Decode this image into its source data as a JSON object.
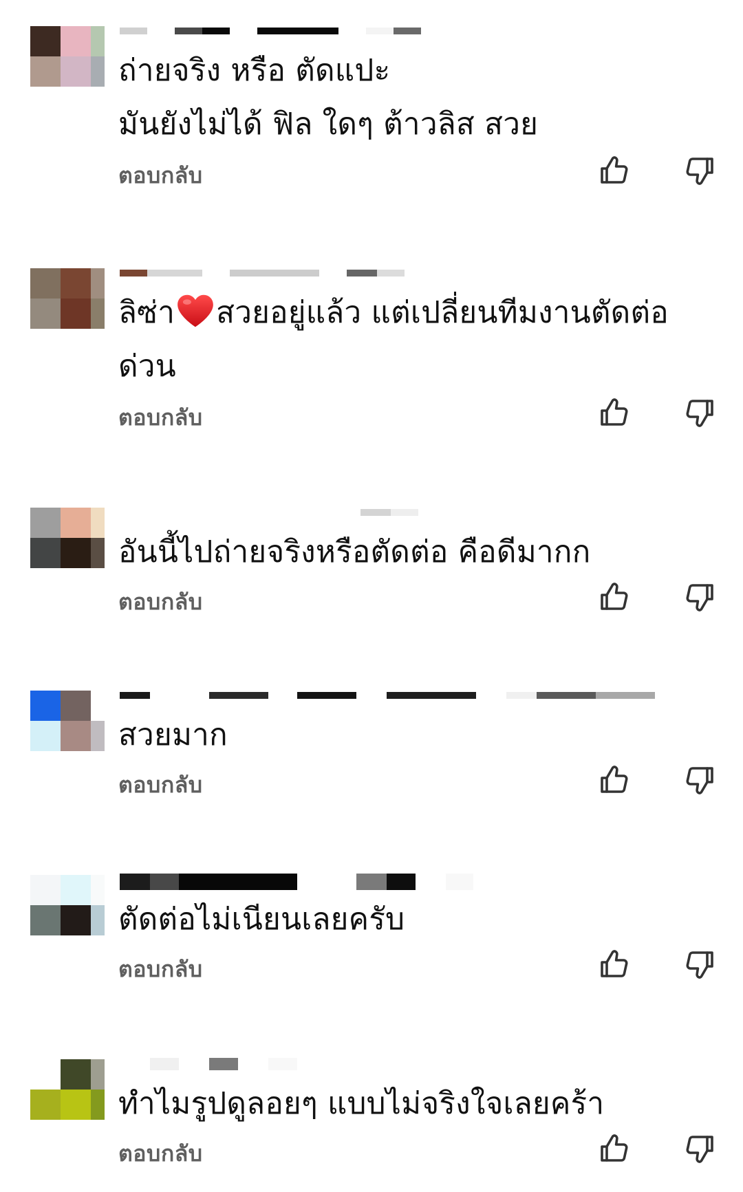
{
  "comments": [
    {
      "text": "ถ่ายจริง หรือ ตัดแปะ\nมันยังไม่ได้ ฟิล ใดๆ ต้าวลิส สวย",
      "reply_label": "ตอบกลับ",
      "like_icon": "thumbs-up-icon",
      "dislike_icon": "thumbs-down-icon",
      "avatar_colors": [
        "#3d2a22",
        "#e8b5c0",
        "#b5c8b0",
        "#b09a8e",
        "#d2b6c5",
        "#a8adb2"
      ]
    },
    {
      "text_before_heart": "ลิซ่า",
      "text_after_heart": "สวยอยู่แล้ว แต่เปลี่ยนทีมงานตัดต่อด่วน",
      "reply_label": "ตอบกลับ",
      "like_icon": "thumbs-up-icon",
      "dislike_icon": "thumbs-down-icon",
      "heart_icon": "red-heart-icon",
      "avatar_colors": [
        "#80705f",
        "#7a4632",
        "#a08e80",
        "#948a7e",
        "#6e3626",
        "#8a7e6a"
      ]
    },
    {
      "text": "อันนี้ไปถ่ายจริงหรือตัดต่อ คือดีมากก",
      "reply_label": "ตอบกลับ",
      "like_icon": "thumbs-up-icon",
      "dislike_icon": "thumbs-down-icon",
      "avatar_colors": [
        "#9e9e9e",
        "#e6ae96",
        "#f0dcc0",
        "#434545",
        "#2a1d14",
        "#5a4e44"
      ]
    },
    {
      "text": "สวยมาก",
      "reply_label": "ตอบกลับ",
      "like_icon": "thumbs-up-icon",
      "dislike_icon": "thumbs-down-icon",
      "avatar_colors": [
        "#1a64e6",
        "#736360",
        "#ffffff",
        "#d4f0f8",
        "#a88a84",
        "#c0bcc0"
      ]
    },
    {
      "text": "ตัดต่อไม่เนียนเลยครับ",
      "reply_label": "ตอบกลับ",
      "like_icon": "thumbs-up-icon",
      "dislike_icon": "thumbs-down-icon",
      "avatar_colors": [
        "#f4f6f8",
        "#e0f6fa",
        "#f8fafa",
        "#6a7672",
        "#221b18",
        "#b8ccd4"
      ]
    },
    {
      "text": "ทำไมรูปดูลอยๆ แบบไม่จริงใจเลยคร้า",
      "reply_label": "ตอบกลับ",
      "like_icon": "thumbs-up-icon",
      "dislike_icon": "thumbs-down-icon",
      "avatar_colors": [
        "#ffffff",
        "#404828",
        "#9e9e90",
        "#a6b01e",
        "#b8c414",
        "#849a1e"
      ]
    }
  ],
  "colors": {
    "reply_text": "#5f5f5f",
    "comment_text": "#111111",
    "heart": "#e21b23"
  }
}
